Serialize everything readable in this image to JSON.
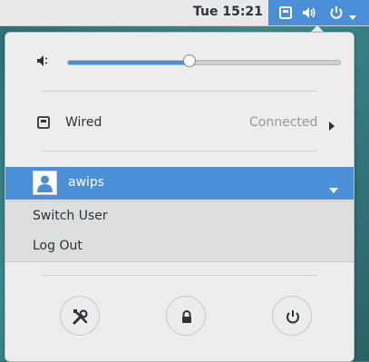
{
  "topbar": {
    "clock": "Tue 15:21",
    "status_icons": [
      "network-wired-icon",
      "volume-icon",
      "power-icon"
    ]
  },
  "menu": {
    "volume": {
      "icon": "speaker-icon",
      "level_percent": 45
    },
    "wired": {
      "label": "Wired",
      "status": "Connected",
      "icon": "wired-network-icon"
    },
    "user": {
      "name": "awips",
      "icon": "avatar-icon"
    },
    "user_submenu": {
      "items": [
        "Switch User",
        "Log Out"
      ]
    },
    "actions": [
      "settings-icon",
      "lock-icon",
      "power-icon"
    ]
  },
  "colors": {
    "accent": "#4a90d9",
    "menu_bg": "#ededed",
    "text": "#2e3436"
  }
}
